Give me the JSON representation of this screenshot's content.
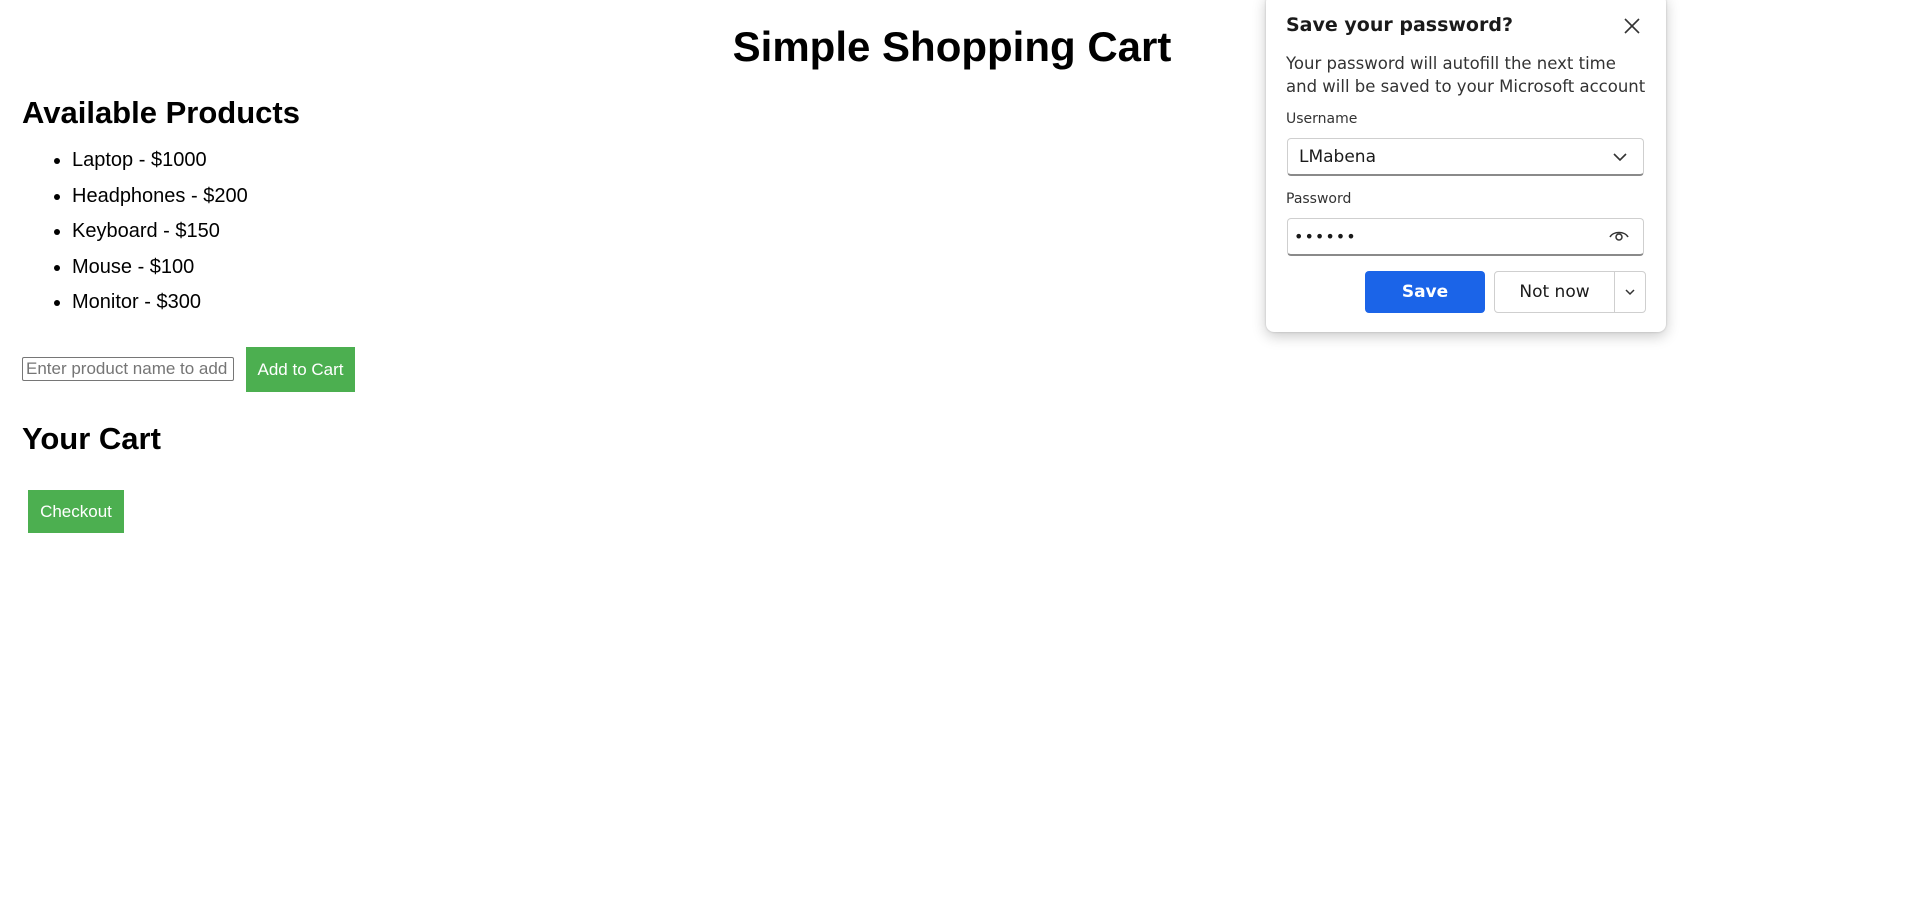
{
  "page": {
    "title": "Simple Shopping Cart"
  },
  "products": {
    "heading": "Available Products",
    "items": [
      "Laptop - $1000",
      "Headphones - $200",
      "Keyboard - $150",
      "Mouse - $100",
      "Monitor - $300"
    ]
  },
  "add_form": {
    "placeholder": "Enter product name to add to cart",
    "value": "",
    "button_label": "Add to Cart"
  },
  "cart": {
    "heading": "Your Cart",
    "checkout_label": "Checkout"
  },
  "save_password_dialog": {
    "title": "Save your password?",
    "description": "Your password will autofill the next time and will be saved to your Microsoft account",
    "username_label": "Username",
    "username_value": "LMabena",
    "password_label": "Password",
    "password_masked": "••••••",
    "save_label": "Save",
    "not_now_label": "Not now",
    "icons": [
      "close-icon",
      "chevron-down-icon",
      "eye-icon"
    ]
  },
  "colors": {
    "green_button": "#4caf50",
    "save_button": "#1b64e8"
  }
}
